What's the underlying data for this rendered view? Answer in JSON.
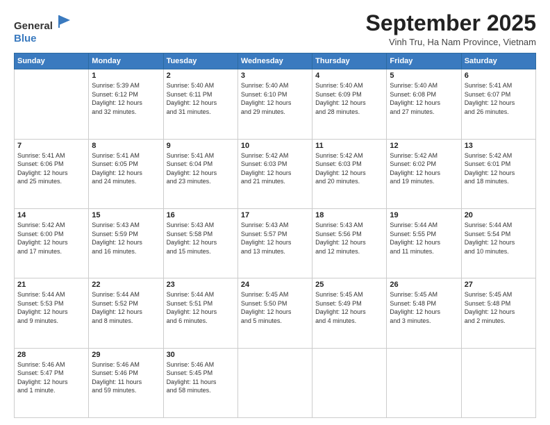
{
  "header": {
    "logo_general": "General",
    "logo_blue": "Blue",
    "month_title": "September 2025",
    "subtitle": "Vinh Tru, Ha Nam Province, Vietnam"
  },
  "weekdays": [
    "Sunday",
    "Monday",
    "Tuesday",
    "Wednesday",
    "Thursday",
    "Friday",
    "Saturday"
  ],
  "weeks": [
    [
      {
        "day": "",
        "info": ""
      },
      {
        "day": "1",
        "info": "Sunrise: 5:39 AM\nSunset: 6:12 PM\nDaylight: 12 hours\nand 32 minutes."
      },
      {
        "day": "2",
        "info": "Sunrise: 5:40 AM\nSunset: 6:11 PM\nDaylight: 12 hours\nand 31 minutes."
      },
      {
        "day": "3",
        "info": "Sunrise: 5:40 AM\nSunset: 6:10 PM\nDaylight: 12 hours\nand 29 minutes."
      },
      {
        "day": "4",
        "info": "Sunrise: 5:40 AM\nSunset: 6:09 PM\nDaylight: 12 hours\nand 28 minutes."
      },
      {
        "day": "5",
        "info": "Sunrise: 5:40 AM\nSunset: 6:08 PM\nDaylight: 12 hours\nand 27 minutes."
      },
      {
        "day": "6",
        "info": "Sunrise: 5:41 AM\nSunset: 6:07 PM\nDaylight: 12 hours\nand 26 minutes."
      }
    ],
    [
      {
        "day": "7",
        "info": "Sunrise: 5:41 AM\nSunset: 6:06 PM\nDaylight: 12 hours\nand 25 minutes."
      },
      {
        "day": "8",
        "info": "Sunrise: 5:41 AM\nSunset: 6:05 PM\nDaylight: 12 hours\nand 24 minutes."
      },
      {
        "day": "9",
        "info": "Sunrise: 5:41 AM\nSunset: 6:04 PM\nDaylight: 12 hours\nand 23 minutes."
      },
      {
        "day": "10",
        "info": "Sunrise: 5:42 AM\nSunset: 6:03 PM\nDaylight: 12 hours\nand 21 minutes."
      },
      {
        "day": "11",
        "info": "Sunrise: 5:42 AM\nSunset: 6:03 PM\nDaylight: 12 hours\nand 20 minutes."
      },
      {
        "day": "12",
        "info": "Sunrise: 5:42 AM\nSunset: 6:02 PM\nDaylight: 12 hours\nand 19 minutes."
      },
      {
        "day": "13",
        "info": "Sunrise: 5:42 AM\nSunset: 6:01 PM\nDaylight: 12 hours\nand 18 minutes."
      }
    ],
    [
      {
        "day": "14",
        "info": "Sunrise: 5:42 AM\nSunset: 6:00 PM\nDaylight: 12 hours\nand 17 minutes."
      },
      {
        "day": "15",
        "info": "Sunrise: 5:43 AM\nSunset: 5:59 PM\nDaylight: 12 hours\nand 16 minutes."
      },
      {
        "day": "16",
        "info": "Sunrise: 5:43 AM\nSunset: 5:58 PM\nDaylight: 12 hours\nand 15 minutes."
      },
      {
        "day": "17",
        "info": "Sunrise: 5:43 AM\nSunset: 5:57 PM\nDaylight: 12 hours\nand 13 minutes."
      },
      {
        "day": "18",
        "info": "Sunrise: 5:43 AM\nSunset: 5:56 PM\nDaylight: 12 hours\nand 12 minutes."
      },
      {
        "day": "19",
        "info": "Sunrise: 5:44 AM\nSunset: 5:55 PM\nDaylight: 12 hours\nand 11 minutes."
      },
      {
        "day": "20",
        "info": "Sunrise: 5:44 AM\nSunset: 5:54 PM\nDaylight: 12 hours\nand 10 minutes."
      }
    ],
    [
      {
        "day": "21",
        "info": "Sunrise: 5:44 AM\nSunset: 5:53 PM\nDaylight: 12 hours\nand 9 minutes."
      },
      {
        "day": "22",
        "info": "Sunrise: 5:44 AM\nSunset: 5:52 PM\nDaylight: 12 hours\nand 8 minutes."
      },
      {
        "day": "23",
        "info": "Sunrise: 5:44 AM\nSunset: 5:51 PM\nDaylight: 12 hours\nand 6 minutes."
      },
      {
        "day": "24",
        "info": "Sunrise: 5:45 AM\nSunset: 5:50 PM\nDaylight: 12 hours\nand 5 minutes."
      },
      {
        "day": "25",
        "info": "Sunrise: 5:45 AM\nSunset: 5:49 PM\nDaylight: 12 hours\nand 4 minutes."
      },
      {
        "day": "26",
        "info": "Sunrise: 5:45 AM\nSunset: 5:48 PM\nDaylight: 12 hours\nand 3 minutes."
      },
      {
        "day": "27",
        "info": "Sunrise: 5:45 AM\nSunset: 5:48 PM\nDaylight: 12 hours\nand 2 minutes."
      }
    ],
    [
      {
        "day": "28",
        "info": "Sunrise: 5:46 AM\nSunset: 5:47 PM\nDaylight: 12 hours\nand 1 minute."
      },
      {
        "day": "29",
        "info": "Sunrise: 5:46 AM\nSunset: 5:46 PM\nDaylight: 11 hours\nand 59 minutes."
      },
      {
        "day": "30",
        "info": "Sunrise: 5:46 AM\nSunset: 5:45 PM\nDaylight: 11 hours\nand 58 minutes."
      },
      {
        "day": "",
        "info": ""
      },
      {
        "day": "",
        "info": ""
      },
      {
        "day": "",
        "info": ""
      },
      {
        "day": "",
        "info": ""
      }
    ]
  ]
}
